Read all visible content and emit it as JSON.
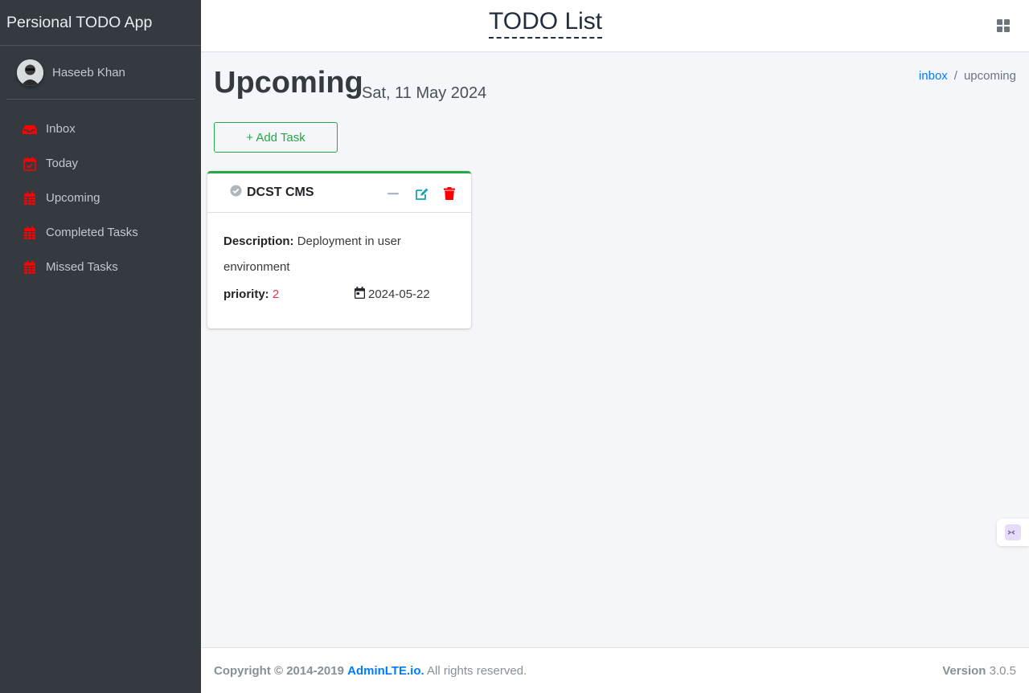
{
  "brand": {
    "name": "Persional TODO App"
  },
  "user": {
    "name": "Haseeb Khan"
  },
  "sidebar": {
    "items": [
      {
        "label": "Inbox",
        "icon": "inbox-icon"
      },
      {
        "label": "Today",
        "icon": "calendar-check-icon"
      },
      {
        "label": "Upcoming",
        "icon": "calendar-icon"
      },
      {
        "label": "Completed Tasks",
        "icon": "calendar-icon"
      },
      {
        "label": "Missed Tasks",
        "icon": "calendar-icon"
      }
    ]
  },
  "topbar": {
    "title": "TODO List",
    "grid_icon": "grid-icon"
  },
  "page": {
    "title": "Upcoming",
    "date": "Sat, 11 May 2024"
  },
  "breadcrumb": {
    "link": "inbox",
    "separator": "/",
    "current": "upcoming"
  },
  "actions": {
    "add_task": "+ Add Task"
  },
  "task": {
    "title": "DCST CMS",
    "description_label": "Description:",
    "description": "Deployment in user environment",
    "priority_label": "priority:",
    "priority": "2",
    "due_date": "2024-05-22"
  },
  "footer": {
    "copyright": "Copyright © 2014-2019",
    "link": "AdminLTE.io.",
    "rights": "All rights reserved.",
    "version_label": "Version",
    "version": "3.0.5"
  },
  "colors": {
    "sidebar_bg": "#343a40",
    "accent_green": "#28a745",
    "link_blue": "#007bff",
    "danger_red": "#dc3545",
    "icon_red": "#ff0000",
    "edit_teal": "#17a2b8"
  }
}
